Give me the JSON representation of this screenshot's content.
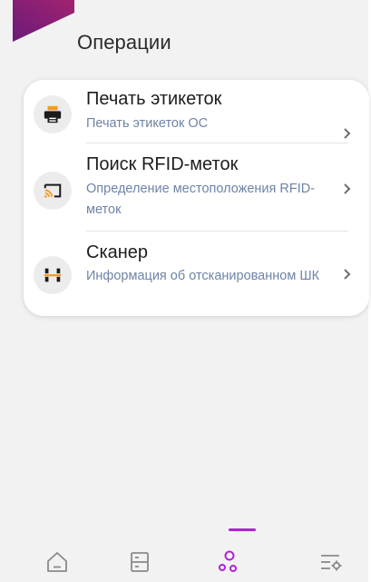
{
  "header": {
    "title": "Операции"
  },
  "operations": [
    {
      "title": "Печать этикеток",
      "subtitle": "Печать этикеток ОС",
      "icon": "printer-icon",
      "icon_color": "#f39b20"
    },
    {
      "title": "Поиск RFID-меток",
      "subtitle": "Определение местоположения RFID-меток",
      "icon": "cast-signal-icon",
      "icon_color": "#f39b20"
    },
    {
      "title": "Сканер",
      "subtitle": "Информация об отсканированном ШК",
      "icon": "scanner-icon",
      "icon_color": "#f39b20"
    }
  ],
  "nav": {
    "items": [
      {
        "icon": "home-icon",
        "active": false
      },
      {
        "icon": "list-icon",
        "active": false
      },
      {
        "icon": "operations-icon",
        "active": true
      },
      {
        "icon": "settings-icon",
        "active": false
      }
    ],
    "active_color": "#b122d4",
    "inactive_color": "#8a8a8a"
  },
  "colors": {
    "accent": "#b122d4",
    "icon_orange": "#f39b20",
    "subtitle": "#6e84a6",
    "background": "#f2f2f2"
  }
}
